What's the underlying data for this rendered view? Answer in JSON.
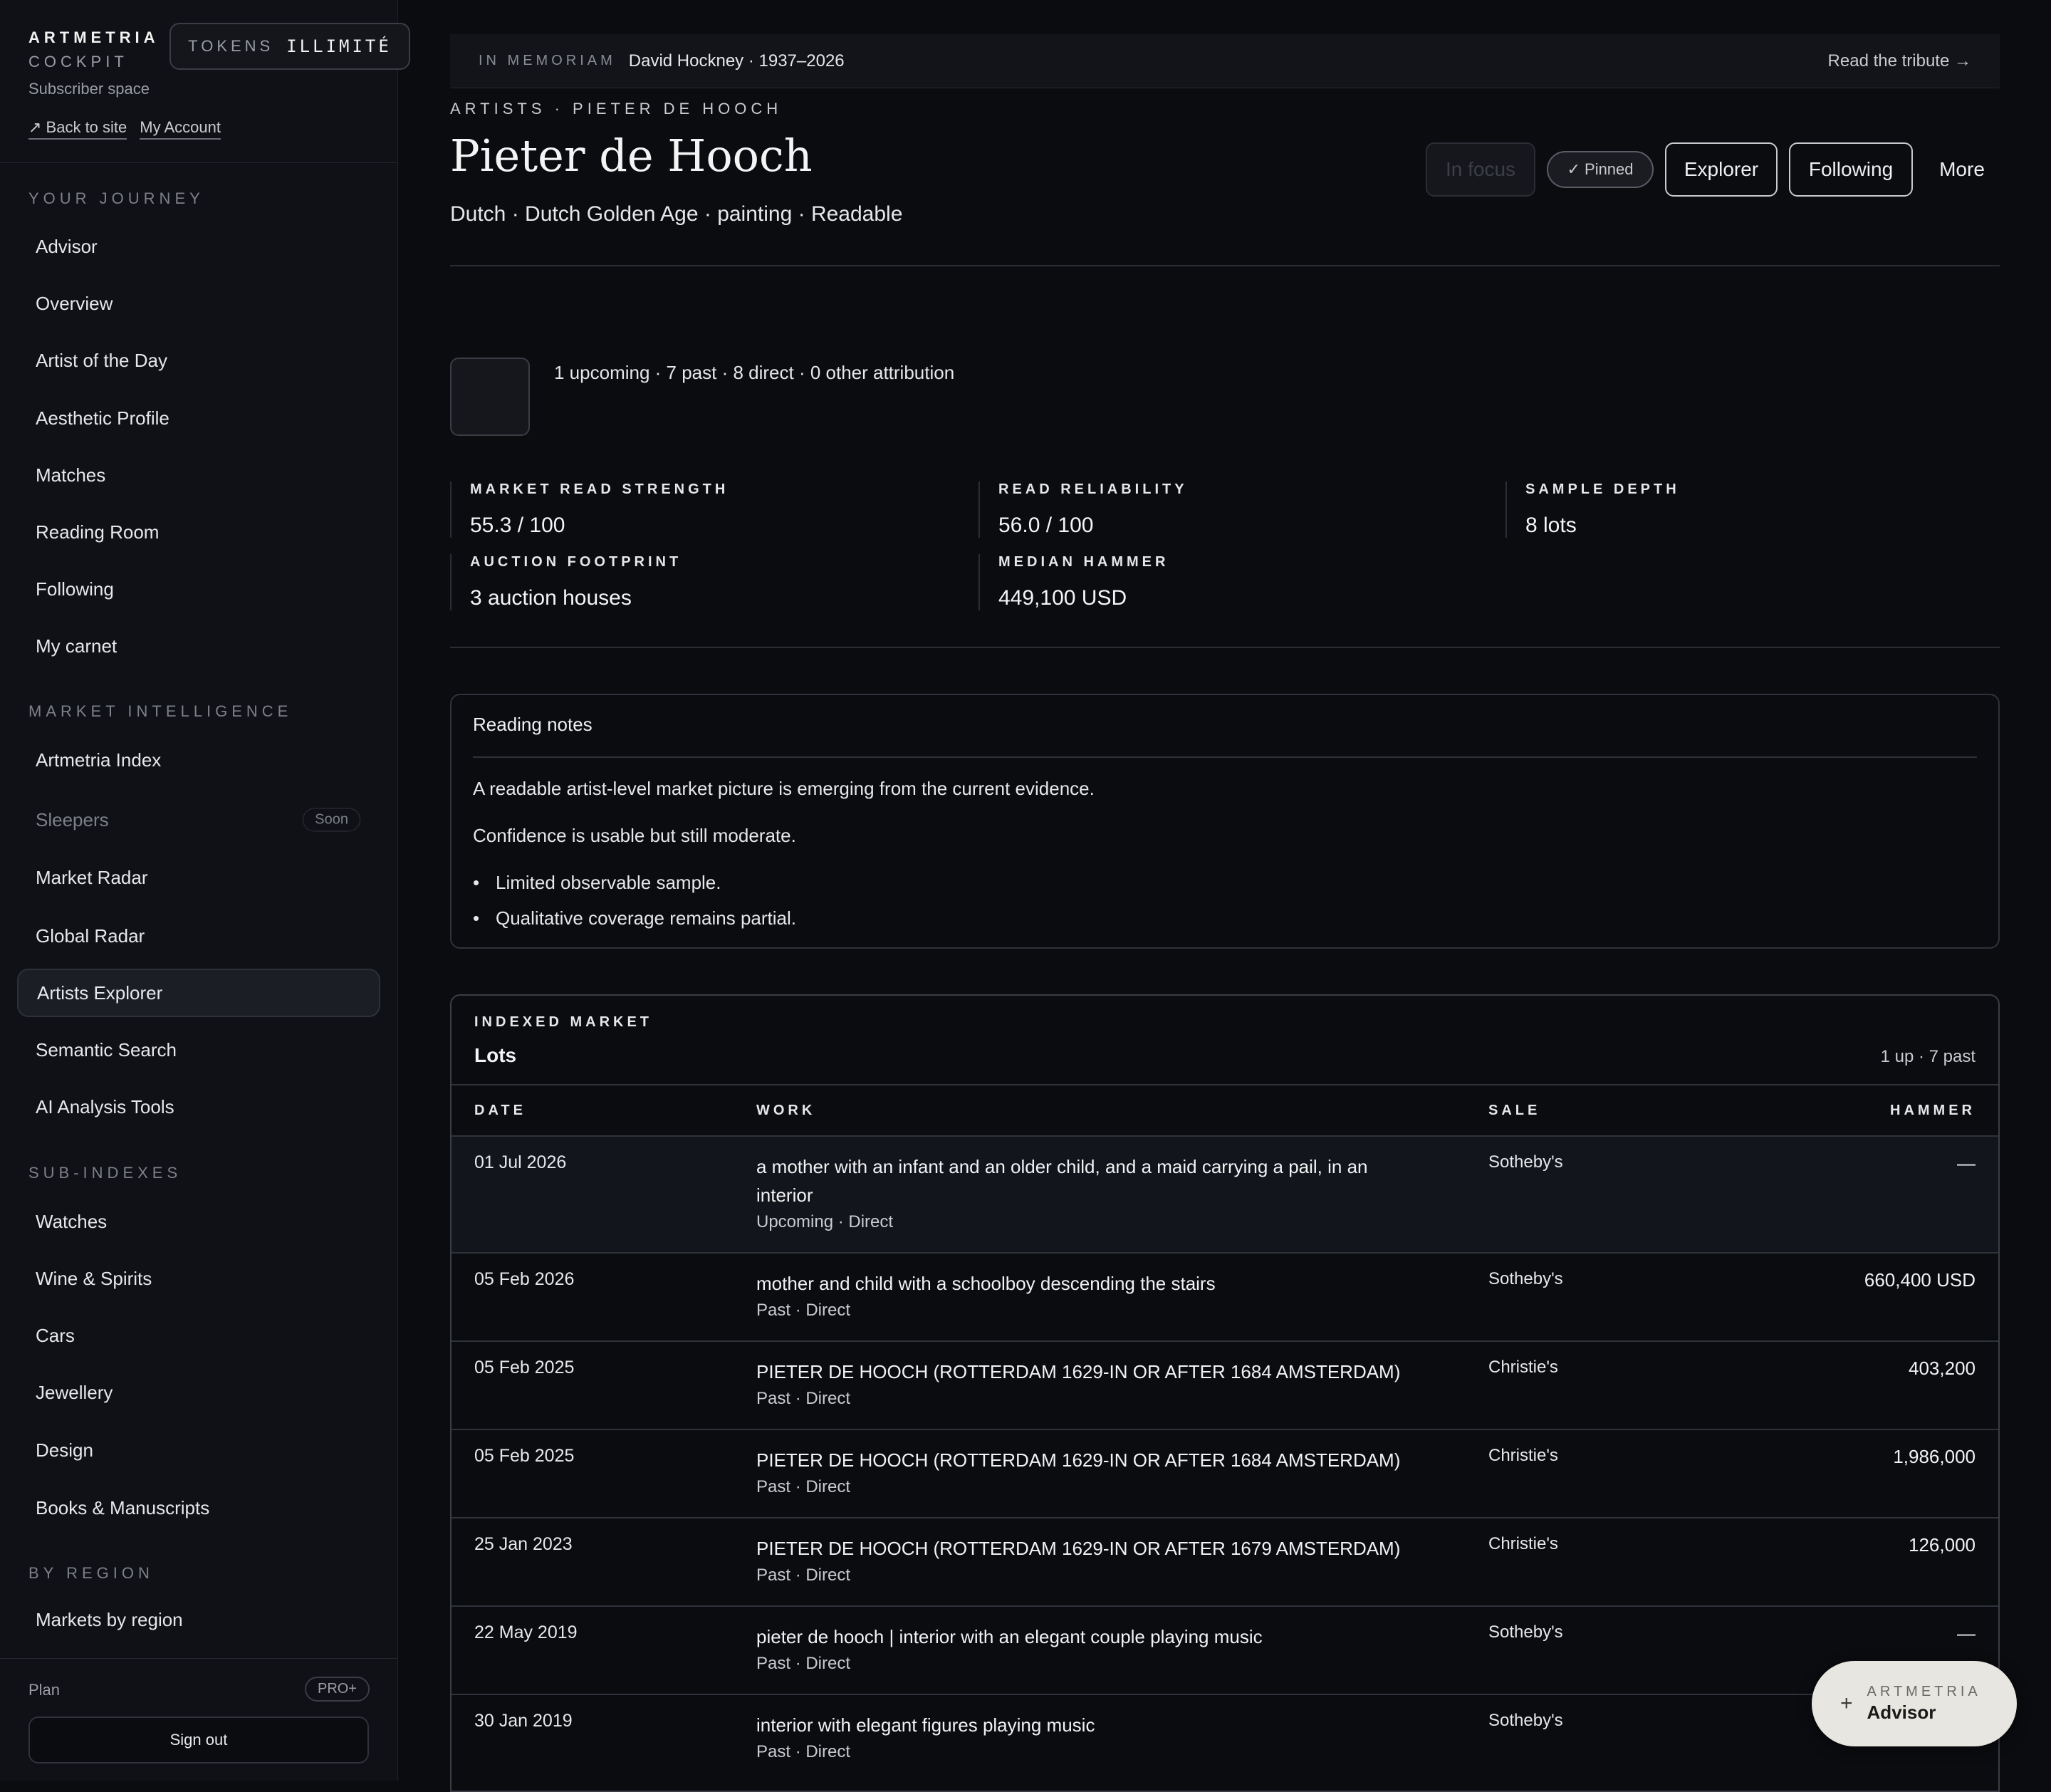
{
  "brand": {
    "name": "ARTMETRIA",
    "sub": "COCKPIT",
    "subscriber": "Subscriber space"
  },
  "tokens": {
    "label": "TOKENS",
    "value": "ILLIMITÉ"
  },
  "account_links": {
    "back": "↗ Back to site",
    "account": "My Account"
  },
  "sidebar": {
    "sections": [
      {
        "label": "YOUR JOURNEY",
        "items": [
          "Advisor",
          "Overview",
          "Artist of the Day",
          "Aesthetic Profile",
          "Matches",
          "Reading Room",
          "Following",
          "My carnet"
        ]
      },
      {
        "label": "MARKET INTELLIGENCE",
        "items": [
          "Artmetria Index",
          "Sleepers",
          "Market Radar",
          "Global Radar",
          "Artists Explorer",
          "Semantic Search",
          "AI Analysis Tools"
        ]
      },
      {
        "label": "SUB-INDEXES",
        "items": [
          "Watches",
          "Wine & Spirits",
          "Cars",
          "Jewellery",
          "Design",
          "Books & Manuscripts"
        ]
      },
      {
        "label": "BY REGION",
        "items": [
          "Markets by region"
        ]
      }
    ],
    "active_item": "Artists Explorer",
    "soon_badge": "Soon",
    "plan_label": "Plan",
    "plan_badge": "PRO+",
    "signout": "Sign out"
  },
  "memoriam": {
    "label": "IN MEMORIAM",
    "text": "David Hockney · 1937–2026",
    "link": "Read the tribute →"
  },
  "breadcrumb": "ARTISTS · PIETER DE HOOCH",
  "title": "Pieter de Hooch",
  "subtitle": "Dutch · Dutch Golden Age · painting · Readable",
  "actions": {
    "focus": "In focus",
    "pinned": "✓ Pinned",
    "explorer": "Explorer",
    "following": "Following",
    "more": "More"
  },
  "counts": "1 upcoming · 7 past · 8 direct · 0 other attribution",
  "metrics": [
    {
      "label": "MARKET READ STRENGTH",
      "value": "55.3 / 100"
    },
    {
      "label": "READ RELIABILITY",
      "value": "56.0 / 100"
    },
    {
      "label": "SAMPLE DEPTH",
      "value": "8 lots"
    },
    {
      "label": "AUCTION FOOTPRINT",
      "value": "3 auction houses"
    },
    {
      "label": "MEDIAN HAMMER",
      "value": "449,100 USD"
    }
  ],
  "notes": {
    "title": "Reading notes",
    "paragraphs": [
      "A readable artist-level market picture is emerging from the current evidence.",
      "Confidence is usable but still moderate."
    ],
    "bullets": [
      "Limited observable sample.",
      "Qualitative coverage remains partial."
    ]
  },
  "lots": {
    "eyebrow": "INDEXED MARKET",
    "title": "Lots",
    "count": "1 up · 7 past",
    "columns": [
      "DATE",
      "WORK",
      "SALE",
      "HAMMER"
    ],
    "rows": [
      {
        "date": "01 Jul 2026",
        "work": "a mother with an infant and an older child, and a maid carrying a pail, in an interior",
        "meta": "Upcoming · Direct",
        "sale": "Sotheby's",
        "hammer": "—"
      },
      {
        "date": "05 Feb 2026",
        "work": "mother and child with a schoolboy descending the stairs",
        "meta": "Past · Direct",
        "sale": "Sotheby's",
        "hammer": "660,400 USD"
      },
      {
        "date": "05 Feb 2025",
        "work": "PIETER DE HOOCH (ROTTERDAM 1629-IN OR AFTER 1684 AMSTERDAM)",
        "meta": "Past · Direct",
        "sale": "Christie's",
        "hammer": "403,200"
      },
      {
        "date": "05 Feb 2025",
        "work": "PIETER DE HOOCH (ROTTERDAM 1629-IN OR AFTER 1684 AMSTERDAM)",
        "meta": "Past · Direct",
        "sale": "Christie's",
        "hammer": "1,986,000"
      },
      {
        "date": "25 Jan 2023",
        "work": "PIETER DE HOOCH (ROTTERDAM 1629-IN OR AFTER 1679 AMSTERDAM)",
        "meta": "Past · Direct",
        "sale": "Christie's",
        "hammer": "126,000"
      },
      {
        "date": "22 May 2019",
        "work": "pieter de hooch | interior with an elegant couple playing music",
        "meta": "Past · Direct",
        "sale": "Sotheby's",
        "hammer": "—"
      },
      {
        "date": "30 Jan 2019",
        "work": "interior with elegant figures playing music",
        "meta": "Past · Direct",
        "sale": "Sotheby's",
        "hammer": ""
      }
    ]
  },
  "advisor": {
    "eyebrow": "ARTMETRIA",
    "label": "Advisor",
    "icon": "plus-icon"
  }
}
